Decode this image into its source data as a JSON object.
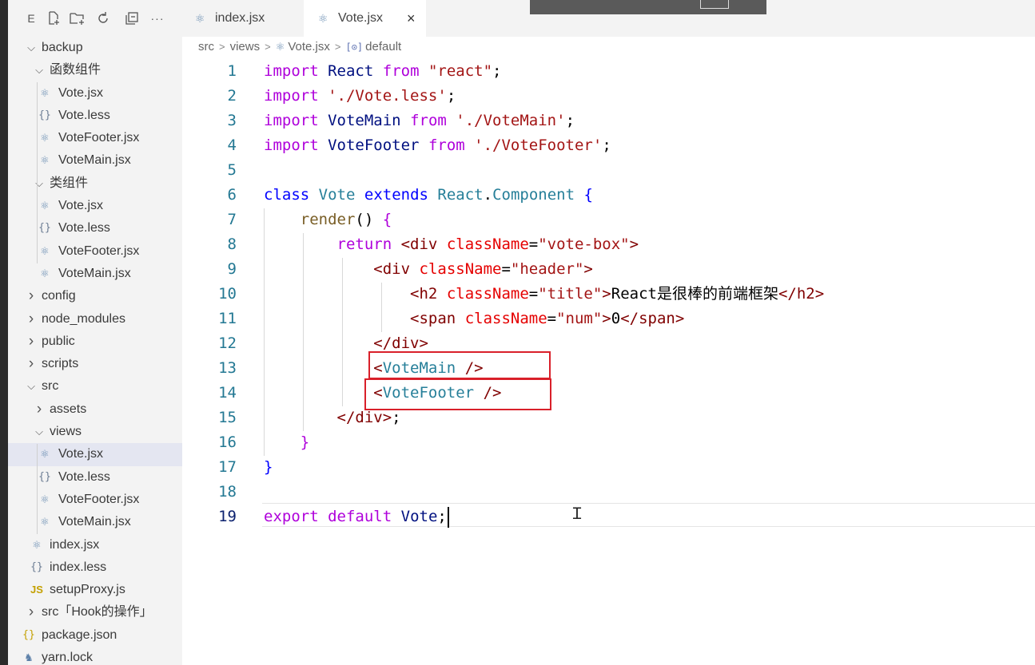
{
  "sidebar": {
    "toolbar": {
      "explorer_letter": "E",
      "new_file": "new-file",
      "new_folder": "new-folder",
      "refresh": "refresh",
      "collapse": "collapse",
      "more": "···"
    },
    "tree": [
      {
        "label": "backup",
        "type": "folder",
        "expanded": true,
        "depth": 0
      },
      {
        "label": "函数组件",
        "type": "folder",
        "expanded": true,
        "depth": 1
      },
      {
        "label": "Vote.jsx",
        "type": "react",
        "depth": 2
      },
      {
        "label": "Vote.less",
        "type": "less",
        "depth": 2
      },
      {
        "label": "VoteFooter.jsx",
        "type": "react",
        "depth": 2
      },
      {
        "label": "VoteMain.jsx",
        "type": "react",
        "depth": 2
      },
      {
        "label": "类组件",
        "type": "folder",
        "expanded": true,
        "depth": 1
      },
      {
        "label": "Vote.jsx",
        "type": "react",
        "depth": 2
      },
      {
        "label": "Vote.less",
        "type": "less",
        "depth": 2
      },
      {
        "label": "VoteFooter.jsx",
        "type": "react",
        "depth": 2
      },
      {
        "label": "VoteMain.jsx",
        "type": "react",
        "depth": 2
      },
      {
        "label": "config",
        "type": "folder",
        "expanded": false,
        "depth": 0
      },
      {
        "label": "node_modules",
        "type": "folder",
        "expanded": false,
        "depth": 0
      },
      {
        "label": "public",
        "type": "folder",
        "expanded": false,
        "depth": 0
      },
      {
        "label": "scripts",
        "type": "folder",
        "expanded": false,
        "depth": 0
      },
      {
        "label": "src",
        "type": "folder",
        "expanded": true,
        "depth": 0
      },
      {
        "label": "assets",
        "type": "folder",
        "expanded": false,
        "depth": 1
      },
      {
        "label": "views",
        "type": "folder",
        "expanded": true,
        "depth": 1
      },
      {
        "label": "Vote.jsx",
        "type": "react",
        "depth": 2,
        "selected": true
      },
      {
        "label": "Vote.less",
        "type": "less",
        "depth": 2
      },
      {
        "label": "VoteFooter.jsx",
        "type": "react",
        "depth": 2
      },
      {
        "label": "VoteMain.jsx",
        "type": "react",
        "depth": 2
      },
      {
        "label": "index.jsx",
        "type": "react",
        "depth": 1
      },
      {
        "label": "index.less",
        "type": "less",
        "depth": 1
      },
      {
        "label": "setupProxy.js",
        "type": "js",
        "depth": 1
      },
      {
        "label": "src「Hook的操作」",
        "type": "folder",
        "expanded": false,
        "depth": 0
      },
      {
        "label": "package.json",
        "type": "json",
        "depth": 0
      },
      {
        "label": "yarn.lock",
        "type": "yarn",
        "depth": 0
      }
    ]
  },
  "tabs": [
    {
      "label": "index.jsx",
      "active": false
    },
    {
      "label": "Vote.jsx",
      "active": true,
      "close": "×"
    }
  ],
  "breadcrumb": {
    "parts": [
      "src",
      "views",
      "Vote.jsx",
      "default"
    ],
    "separator": ">",
    "symbol_icon": "[⊙]"
  },
  "editor": {
    "current_line": 19,
    "lines": [
      {
        "n": "1",
        "tokens": [
          [
            "kw",
            "import"
          ],
          [
            "",
            " "
          ],
          [
            "id",
            "React"
          ],
          [
            "",
            " "
          ],
          [
            "kw",
            "from"
          ],
          [
            "",
            " "
          ],
          [
            "str",
            "\"react\""
          ],
          [
            "",
            ";"
          ]
        ]
      },
      {
        "n": "2",
        "tokens": [
          [
            "kw",
            "import"
          ],
          [
            "",
            " "
          ],
          [
            "str",
            "'./Vote.less'"
          ],
          [
            "",
            ";"
          ]
        ]
      },
      {
        "n": "3",
        "tokens": [
          [
            "kw",
            "import"
          ],
          [
            "",
            " "
          ],
          [
            "id",
            "VoteMain"
          ],
          [
            "",
            " "
          ],
          [
            "kw",
            "from"
          ],
          [
            "",
            " "
          ],
          [
            "str",
            "'./VoteMain'"
          ],
          [
            "",
            ";"
          ]
        ]
      },
      {
        "n": "4",
        "tokens": [
          [
            "kw",
            "import"
          ],
          [
            "",
            " "
          ],
          [
            "id",
            "VoteFooter"
          ],
          [
            "",
            " "
          ],
          [
            "kw",
            "from"
          ],
          [
            "",
            " "
          ],
          [
            "str",
            "'./VoteFooter'"
          ],
          [
            "",
            ";"
          ]
        ]
      },
      {
        "n": "5",
        "tokens": []
      },
      {
        "n": "6",
        "tokens": [
          [
            "ctrl",
            "class"
          ],
          [
            "",
            " "
          ],
          [
            "cls",
            "Vote"
          ],
          [
            "",
            " "
          ],
          [
            "ctrl",
            "extends"
          ],
          [
            "",
            " "
          ],
          [
            "cls",
            "React"
          ],
          [
            "",
            "."
          ],
          [
            "cls",
            "Component"
          ],
          [
            "",
            " "
          ],
          [
            "ctrl",
            "{"
          ]
        ]
      },
      {
        "n": "7",
        "tokens": [
          [
            "",
            "    "
          ],
          [
            "fn",
            "render"
          ],
          [
            "",
            "() "
          ],
          [
            "kw",
            "{"
          ]
        ]
      },
      {
        "n": "8",
        "tokens": [
          [
            "",
            "        "
          ],
          [
            "kw",
            "return"
          ],
          [
            "",
            " "
          ],
          [
            "tag",
            "<div"
          ],
          [
            "",
            " "
          ],
          [
            "attr",
            "className"
          ],
          [
            "",
            "="
          ],
          [
            "str",
            "\"vote-box\""
          ],
          [
            "tag",
            ">"
          ]
        ]
      },
      {
        "n": "9",
        "tokens": [
          [
            "",
            "            "
          ],
          [
            "tag",
            "<div"
          ],
          [
            "",
            " "
          ],
          [
            "attr",
            "className"
          ],
          [
            "",
            "="
          ],
          [
            "str",
            "\"header\""
          ],
          [
            "tag",
            ">"
          ]
        ]
      },
      {
        "n": "10",
        "tokens": [
          [
            "",
            "                "
          ],
          [
            "tag",
            "<h2"
          ],
          [
            "",
            " "
          ],
          [
            "attr",
            "className"
          ],
          [
            "",
            "="
          ],
          [
            "str",
            "\"title\""
          ],
          [
            "tag",
            ">"
          ],
          [
            "",
            "React是很棒的前端框架"
          ],
          [
            "tag",
            "</h2>"
          ]
        ]
      },
      {
        "n": "11",
        "tokens": [
          [
            "",
            "                "
          ],
          [
            "tag",
            "<span"
          ],
          [
            "",
            " "
          ],
          [
            "attr",
            "className"
          ],
          [
            "",
            "="
          ],
          [
            "str",
            "\"num\""
          ],
          [
            "tag",
            ">"
          ],
          [
            "",
            "0"
          ],
          [
            "tag",
            "</span>"
          ]
        ]
      },
      {
        "n": "12",
        "tokens": [
          [
            "",
            "            "
          ],
          [
            "tag",
            "</div>"
          ]
        ]
      },
      {
        "n": "13",
        "tokens": [
          [
            "",
            "            "
          ],
          [
            "tag",
            "<"
          ],
          [
            "tagc",
            "VoteMain"
          ],
          [
            "",
            " "
          ],
          [
            "tag",
            "/>"
          ]
        ]
      },
      {
        "n": "14",
        "tokens": [
          [
            "",
            "            "
          ],
          [
            "tag",
            "<"
          ],
          [
            "tagc",
            "VoteFooter"
          ],
          [
            "",
            " "
          ],
          [
            "tag",
            "/>"
          ]
        ]
      },
      {
        "n": "15",
        "tokens": [
          [
            "",
            "        "
          ],
          [
            "tag",
            "</div>"
          ],
          [
            "",
            ";"
          ]
        ]
      },
      {
        "n": "16",
        "tokens": [
          [
            "",
            "    "
          ],
          [
            "kw",
            "}"
          ]
        ]
      },
      {
        "n": "17",
        "tokens": [
          [
            "ctrl",
            "}"
          ]
        ]
      },
      {
        "n": "18",
        "tokens": []
      },
      {
        "n": "19",
        "tokens": [
          [
            "kw",
            "export"
          ],
          [
            "",
            " "
          ],
          [
            "kw",
            "default"
          ],
          [
            "",
            " "
          ],
          [
            "id",
            "Vote"
          ],
          [
            "",
            ";"
          ]
        ]
      }
    ],
    "highlight_color": "#d9202a"
  }
}
